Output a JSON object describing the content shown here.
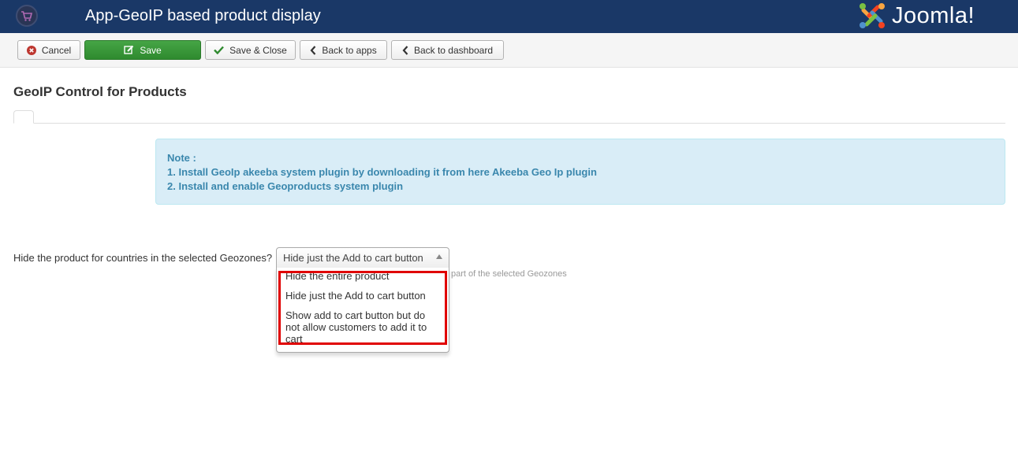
{
  "header": {
    "title": "App-GeoIP based product display",
    "brand": "Joomla!"
  },
  "toolbar": {
    "cancel": "Cancel",
    "save": "Save",
    "save_close": "Save & Close",
    "back_apps": "Back to apps",
    "back_dashboard": "Back to dashboard"
  },
  "page": {
    "title": "GeoIP Control for Products"
  },
  "note": {
    "heading": "Note :",
    "line1": "1. Install GeoIp akeeba system plugin by downloading it from here Akeeba Geo Ip plugin",
    "line2": "2. Install and enable Geoproducts system plugin"
  },
  "form": {
    "label": "Hide the product for countries in the selected Geozones?",
    "selected": "Hide just the Add to cart button",
    "help_partial": "part of the selected Geozones",
    "options": [
      "Hide the entire product",
      "Hide just the Add to cart button",
      "Show add to cart button but do not allow customers to add it to cart"
    ]
  },
  "colors": {
    "header_bg": "#1a3867",
    "save_green": "#3c9a3c",
    "alert_bg": "#d9edf7",
    "alert_text": "#3a87ad",
    "highlight_red": "#e00000"
  }
}
